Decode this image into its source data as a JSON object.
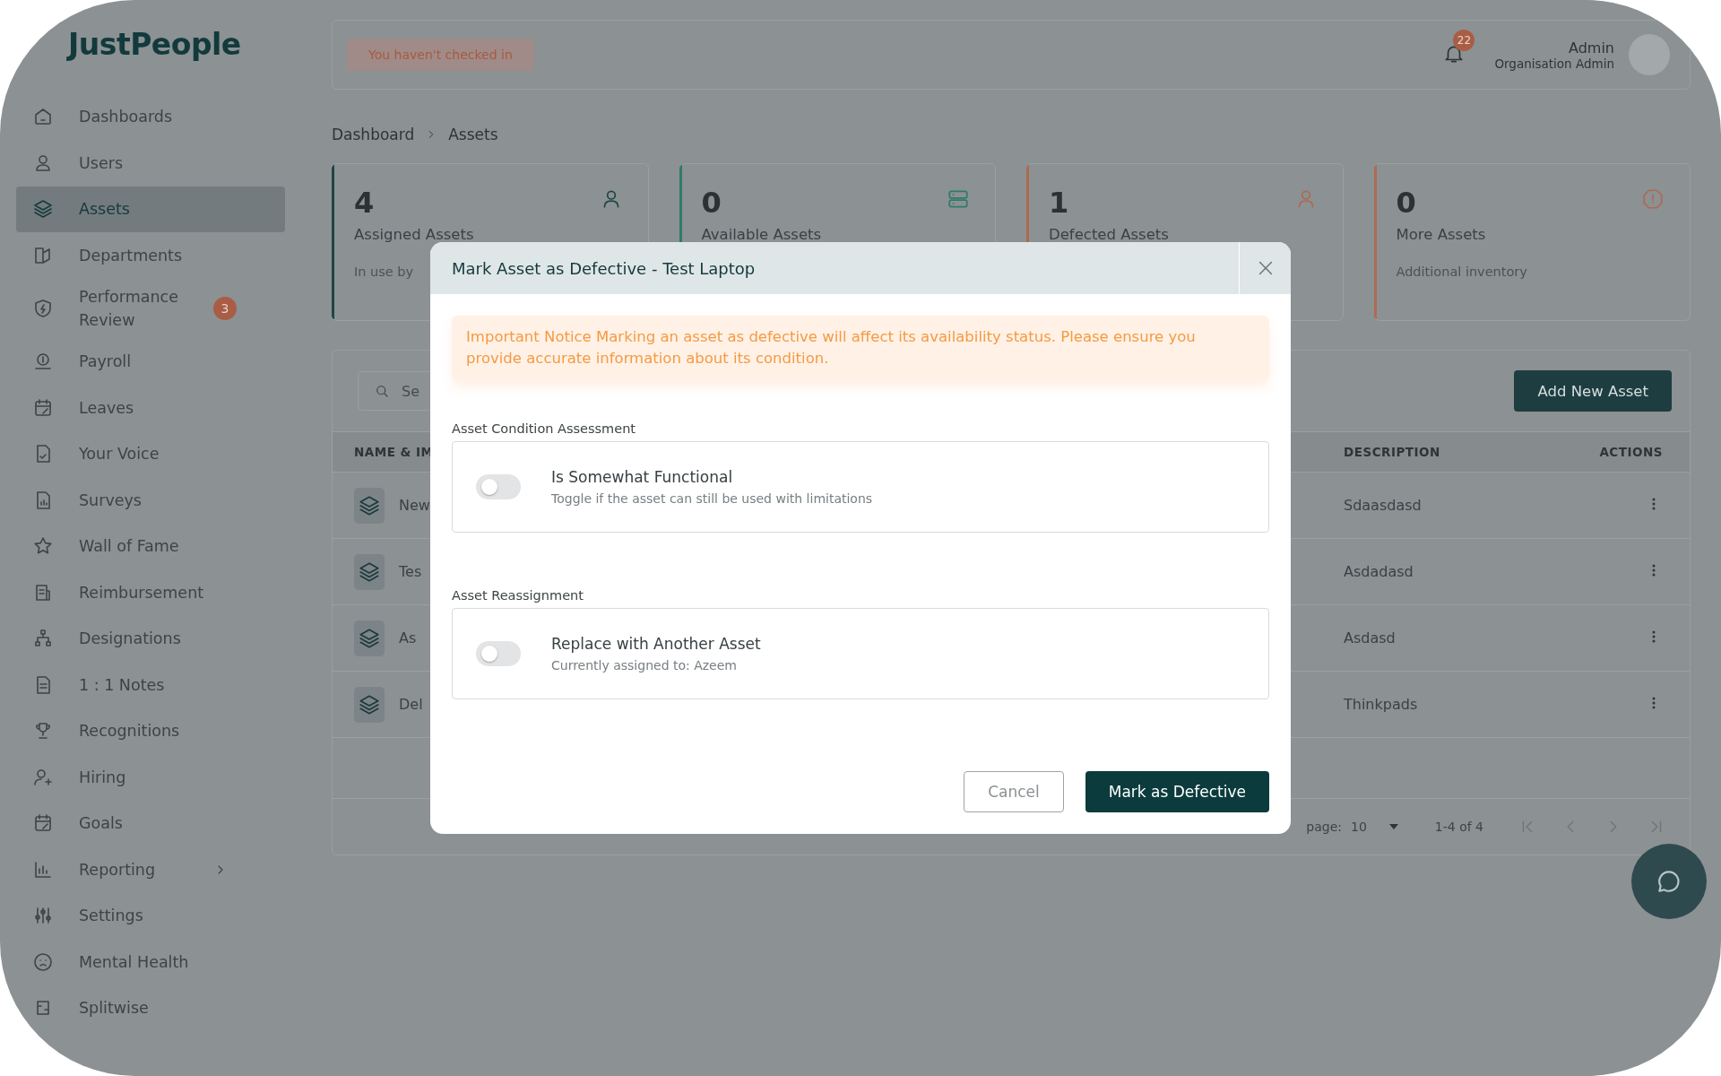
{
  "app": {
    "logo": "JustPeople"
  },
  "sidebar": {
    "items": [
      {
        "label": "Dashboards",
        "selected": false,
        "has_submenu": false
      },
      {
        "label": "Users",
        "selected": false,
        "has_submenu": false
      },
      {
        "label": "Assets",
        "selected": true,
        "has_submenu": false
      },
      {
        "label": "Departments",
        "selected": false,
        "has_submenu": false
      },
      {
        "label": "Performance Review",
        "selected": false,
        "has_submenu": false,
        "badge": "3"
      },
      {
        "label": "Payroll",
        "selected": false,
        "has_submenu": false
      },
      {
        "label": "Leaves",
        "selected": false,
        "has_submenu": false
      },
      {
        "label": "Your Voice",
        "selected": false,
        "has_submenu": false
      },
      {
        "label": "Surveys",
        "selected": false,
        "has_submenu": false
      },
      {
        "label": "Wall of Fame",
        "selected": false,
        "has_submenu": false
      },
      {
        "label": "Reimbursement",
        "selected": false,
        "has_submenu": false
      },
      {
        "label": "Designations",
        "selected": false,
        "has_submenu": false
      },
      {
        "label": "1 : 1 Notes",
        "selected": false,
        "has_submenu": false
      },
      {
        "label": "Recognitions",
        "selected": false,
        "has_submenu": false
      },
      {
        "label": "Hiring",
        "selected": false,
        "has_submenu": false
      },
      {
        "label": "Goals",
        "selected": false,
        "has_submenu": false
      },
      {
        "label": "Reporting",
        "selected": false,
        "has_submenu": true
      },
      {
        "label": "Settings",
        "selected": false,
        "has_submenu": false
      },
      {
        "label": "Mental Health",
        "selected": false,
        "has_submenu": false
      },
      {
        "label": "Splitwise",
        "selected": false,
        "has_submenu": false
      }
    ]
  },
  "top_bar": {
    "checkin_status": "You haven't checked in",
    "notification_count": "22",
    "user": {
      "name": "Admin",
      "role": "Organisation Admin"
    }
  },
  "breadcrumb": [
    "Dashboard",
    "Assets"
  ],
  "stat_cards": [
    {
      "value": "4",
      "label": "Assigned Assets",
      "note": "In use by",
      "color": "#1f4546"
    },
    {
      "value": "0",
      "label": "Available Assets",
      "color": "#2f7b68"
    },
    {
      "value": "1",
      "label": "Defected Assets",
      "color": "#ad6a52"
    },
    {
      "value": "0",
      "label": "More Assets",
      "note": "Additional inventory",
      "color": "#ad6a52"
    }
  ],
  "table": {
    "search": {
      "placeholder": "Se"
    },
    "add_button": "Add New Asset",
    "columns": [
      "NAME & IM",
      "DESCRIPTION",
      "ACTIONS"
    ],
    "rows": [
      {
        "name": "New",
        "description": "Sdaasdasd"
      },
      {
        "name": "Tes",
        "description": "Asdadasd"
      },
      {
        "name": "As",
        "description": "Asdasd"
      },
      {
        "name": "Del",
        "description": "Thinkpads"
      }
    ],
    "pagination": {
      "rows_label": "page:",
      "page_size": "10",
      "range": "1-4 of 4"
    }
  },
  "modal": {
    "title": "Mark Asset as Defective - Test Laptop",
    "notice": "Important Notice Marking an asset as defective will affect its availability status. Please ensure you provide accurate information about its condition.",
    "sections": [
      {
        "label": "Asset Condition Assessment",
        "option": {
          "title": "Is Somewhat Functional",
          "subtitle": "Toggle if the asset can still be used with limitations",
          "on": false
        }
      },
      {
        "label": "Asset Reassignment",
        "option": {
          "title": "Replace with Another Asset",
          "subtitle": "Currently assigned to: Azeem",
          "on": false
        }
      }
    ],
    "buttons": [
      {
        "label": "Cancel",
        "kind": "secondary"
      },
      {
        "label": "Mark as Defective",
        "kind": "primary"
      }
    ]
  }
}
